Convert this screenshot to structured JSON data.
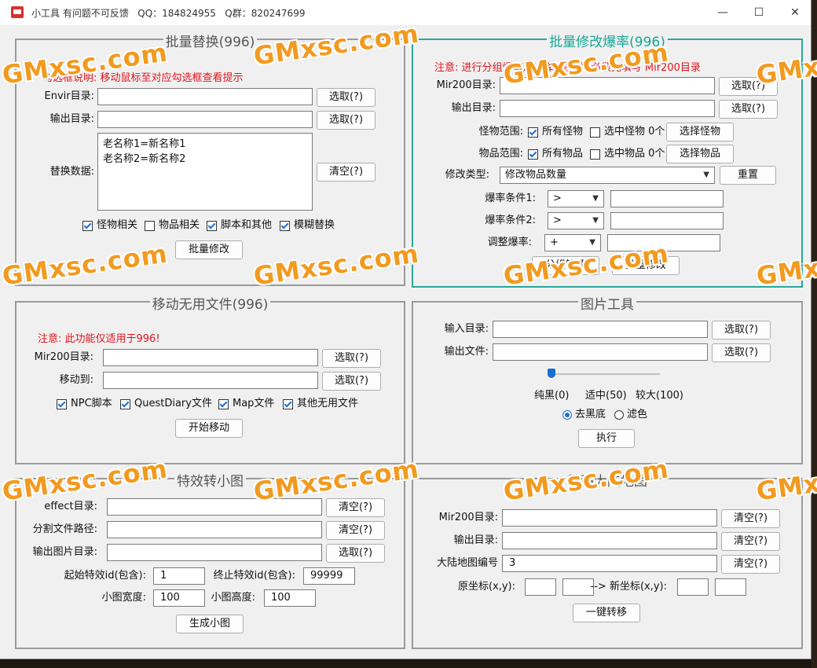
{
  "window": {
    "title": "小工具 有问题不可反馈   QQ：184824955   Q群：820247699",
    "minimize": "—",
    "maximize": "☐",
    "close": "✕"
  },
  "batch_replace": {
    "title": "批量替换(996)",
    "hint": "勾选框说明: 移动鼠标至对应勾选框查看提示",
    "envir_label": "Envir目录:",
    "output_label": "输出目录:",
    "select_label": "选取(?)",
    "data_label": "替换数据:",
    "data_value": "老名称1=新名称1\n老名称2=新名称2",
    "clear_label": "清空(?)",
    "checks": [
      {
        "label": "怪物相关",
        "checked": true
      },
      {
        "label": "物品相关",
        "checked": false
      },
      {
        "label": "脚本和其他",
        "checked": true
      },
      {
        "label": "模糊替换",
        "checked": true
      }
    ],
    "submit_label": "批量修改"
  },
  "batch_drop": {
    "title": "批量修改爆率(996)",
    "notice": "注意: 进行分组爆率及选择范围时, 必须先填写 Mir200目录",
    "mir200_label": "Mir200目录:",
    "output_label": "输出目录:",
    "select_label": "选取(?)",
    "monster_range_label": "怪物范围:",
    "monster_all": "所有怪物",
    "monster_selected": "选中怪物 0个",
    "monster_button": "选择怪物",
    "item_range_label": "物品范围:",
    "item_all": "所有物品",
    "item_selected": "选中物品 0个",
    "item_button": "选择物品",
    "type_label": "修改类型:",
    "type_value": "修改物品数量",
    "reset_label": "重置",
    "cond1_label": "爆率条件1:",
    "cond1_value": ">",
    "cond2_label": "爆率条件2:",
    "cond2_value": ">",
    "adjust_label": "调整爆率:",
    "adjust_value": "+",
    "group_button": "分组管理",
    "submit_label": "批量修改"
  },
  "move_files": {
    "title": "移动无用文件(996)",
    "notice": "注意: 此功能仅适用于996!",
    "mir200_label": "Mir200目录:",
    "move_to_label": "移动到:",
    "select_label": "选取(?)",
    "checks": [
      {
        "label": "NPC脚本",
        "checked": true
      },
      {
        "label": "QuestDiary文件",
        "checked": true
      },
      {
        "label": "Map文件",
        "checked": true
      },
      {
        "label": "其他无用文件",
        "checked": true
      }
    ],
    "submit_label": "开始移动"
  },
  "image_tool": {
    "title": "图片工具",
    "input_label": "输入目录:",
    "output_label": "输出文件:",
    "select_label": "选取(?)",
    "scale_black": "纯黑(0)",
    "scale_mid": "适中(50)",
    "scale_high": "较大(100)",
    "slider_value": 0,
    "radio_remove_black": "去黑底",
    "radio_filter": "滤色",
    "run_label": "执行"
  },
  "effect_thumb": {
    "title": "特效转小图",
    "effect_label": "effect目录:",
    "split_label": "分割文件路径:",
    "output_label": "输出图片目录:",
    "clear_label": "清空(?)",
    "select_label": "选取(?)",
    "start_id_label": "起始特效id(包含):",
    "start_id_value": "1",
    "end_id_label": "终止特效id(包含):",
    "end_id_value": "99999",
    "width_label": "小图宽度:",
    "width_value": "100",
    "height_label": "小图高度:",
    "height_value": "100",
    "submit_label": "生成小图"
  },
  "map_transfer": {
    "title": "转移大陆地图",
    "mir200_label": "Mir200目录:",
    "output_label": "输出目录:",
    "map_no_label": "大陆地图编号",
    "map_no_value": "3",
    "clear_label": "清空(?)",
    "coords_label": "原坐标(x,y):",
    "new_coords_label": "--> 新坐标(x,y):",
    "submit_label": "一键转移"
  },
  "watermark": {
    "text": "GMxsc.com"
  }
}
